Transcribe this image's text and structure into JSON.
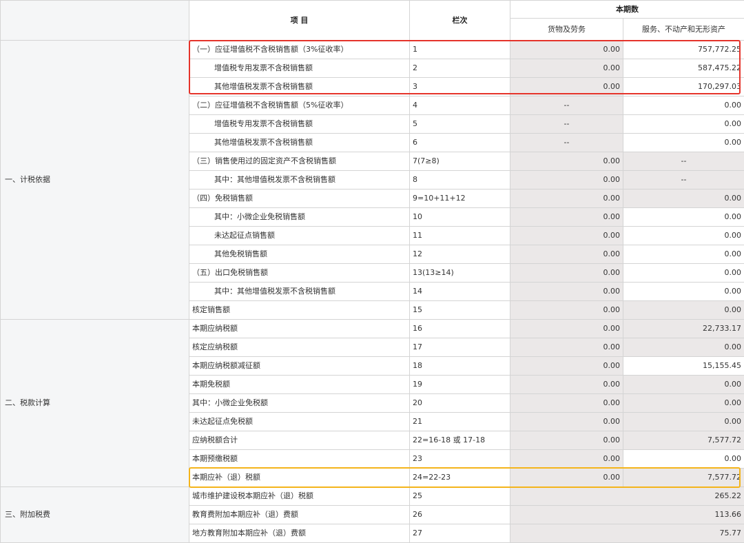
{
  "header": {
    "item": "项  目",
    "col": "栏次",
    "period": "本期数",
    "goods": "货物及劳务",
    "services": "服务、不动产和无形资产"
  },
  "sections": {
    "s1": "一、计税依据",
    "s2": "二、税款计算",
    "s3": "三、附加税费"
  },
  "rows": [
    {
      "item": "（一）应征增值税不含税销售额（3%征收率）",
      "col": "1",
      "goods": "0.00",
      "services": "757,772.25"
    },
    {
      "item": "增值税专用发票不含税销售额",
      "col": "2",
      "goods": "0.00",
      "services": "587,475.22"
    },
    {
      "item": "其他增值税发票不含税销售额",
      "col": "3",
      "goods": "0.00",
      "services": "170,297.03"
    },
    {
      "item": "（二）应征增值税不含税销售额（5%征收率）",
      "col": "4",
      "goods": "--",
      "services": "0.00"
    },
    {
      "item": "增值税专用发票不含税销售额",
      "col": "5",
      "goods": "--",
      "services": "0.00"
    },
    {
      "item": "其他增值税发票不含税销售额",
      "col": "6",
      "goods": "--",
      "services": "0.00"
    },
    {
      "item": "（三）销售使用过的固定资产不含税销售额",
      "col": "7(7≥8)",
      "goods": "0.00",
      "services": "--"
    },
    {
      "item": "其中：其他增值税发票不含税销售额",
      "col": "8",
      "goods": "0.00",
      "services": "--"
    },
    {
      "item": "（四）免税销售额",
      "col": "9=10+11+12",
      "goods": "0.00",
      "services": "0.00"
    },
    {
      "item": "其中：小微企业免税销售额",
      "col": "10",
      "goods": "0.00",
      "services": "0.00"
    },
    {
      "item": "未达起征点销售额",
      "col": "11",
      "goods": "0.00",
      "services": "0.00"
    },
    {
      "item": "其他免税销售额",
      "col": "12",
      "goods": "0.00",
      "services": "0.00"
    },
    {
      "item": "（五）出口免税销售额",
      "col": "13(13≥14)",
      "goods": "0.00",
      "services": "0.00"
    },
    {
      "item": "其中：其他增值税发票不含税销售额",
      "col": "14",
      "goods": "0.00",
      "services": "0.00"
    },
    {
      "item": "核定销售额",
      "col": "15",
      "goods": "0.00",
      "services": "0.00"
    },
    {
      "item": "本期应纳税额",
      "col": "16",
      "goods": "0.00",
      "services": "22,733.17"
    },
    {
      "item": "核定应纳税额",
      "col": "17",
      "goods": "0.00",
      "services": "0.00"
    },
    {
      "item": "本期应纳税额减征额",
      "col": "18",
      "goods": "0.00",
      "services": "15,155.45"
    },
    {
      "item": "本期免税额",
      "col": "19",
      "goods": "0.00",
      "services": "0.00"
    },
    {
      "item": "其中：小微企业免税额",
      "col": "20",
      "goods": "0.00",
      "services": "0.00"
    },
    {
      "item": "未达起征点免税额",
      "col": "21",
      "goods": "0.00",
      "services": "0.00"
    },
    {
      "item": "应纳税额合计",
      "col": "22=16-18 或 17-18",
      "goods": "0.00",
      "services": "7,577.72"
    },
    {
      "item": "本期预缴税额",
      "col": "23",
      "goods": "0.00",
      "services": "0.00"
    },
    {
      "item": "本期应补（退）税额",
      "col": "24=22-23",
      "goods": "0.00",
      "services": "7,577.72"
    },
    {
      "item": "城市维护建设税本期应补（退）税额",
      "col": "25",
      "goods": "",
      "services": "265.22"
    },
    {
      "item": "教育费附加本期应补（退）费额",
      "col": "26",
      "goods": "",
      "services": "113.66"
    },
    {
      "item": "地方教育附加本期应补（退）费额",
      "col": "27",
      "goods": "",
      "services": "75.77"
    }
  ]
}
